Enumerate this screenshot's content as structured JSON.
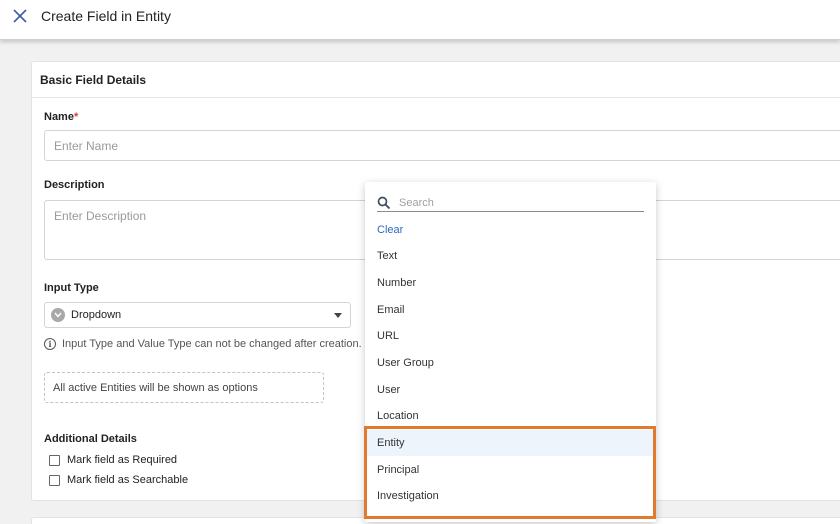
{
  "header": {
    "title": "Create Field in Entity",
    "close_icon": "close-icon"
  },
  "basic": {
    "section_title": "Basic Field Details",
    "name_label": "Name",
    "required_mark": "*",
    "name_placeholder": "Enter Name",
    "description_label": "Description",
    "description_placeholder": "Enter Description",
    "input_type_label": "Input Type",
    "input_type_value": "Dropdown",
    "input_type_note": "Input Type and Value Type can not be changed after creation.",
    "options_note": "All active Entities will be shown as options"
  },
  "additional": {
    "label": "Additional Details",
    "required_checkbox": "Mark field as Required",
    "searchable_checkbox": "Mark field as Searchable"
  },
  "dropdown": {
    "search_placeholder": "Search",
    "clear_label": "Clear",
    "items": [
      "Text",
      "Number",
      "Email",
      "URL",
      "User Group",
      "User",
      "Location",
      "Entity",
      "Principal",
      "Investigation"
    ],
    "hovered_item": "Entity"
  },
  "colors": {
    "highlight": "#e07a2f",
    "link": "#2d6bbf",
    "required": "#d23a3a"
  }
}
